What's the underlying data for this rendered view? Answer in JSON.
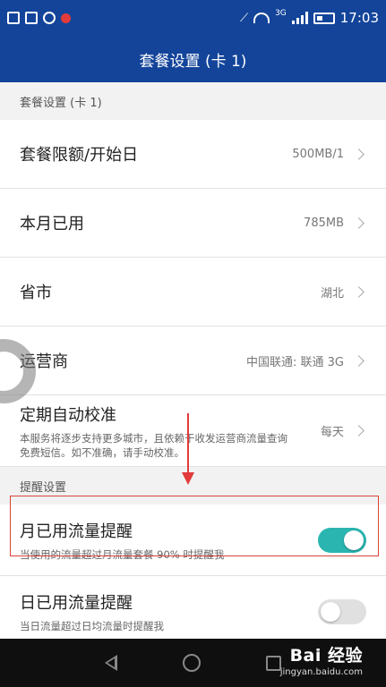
{
  "status_bar": {
    "time": "17:03",
    "network": "3G",
    "notification_icons": [
      "battery-saver-icon",
      "image-icon",
      "pause-icon",
      "red-dot-icon"
    ]
  },
  "title_bar": {
    "title": "套餐设置 (卡 1)"
  },
  "sections": {
    "plan": {
      "header": "套餐设置 (卡 1)"
    },
    "reminders": {
      "header": "提醒设置"
    }
  },
  "plan_rows": {
    "limit": {
      "title": "套餐限额/开始日",
      "value": "500MB/1"
    },
    "used": {
      "title": "本月已用",
      "value": "785MB"
    },
    "province": {
      "title": "省市",
      "value": "湖北"
    },
    "carrier": {
      "title": "运营商",
      "value": "中国联通: 联通 3G"
    },
    "auto_calibrate": {
      "title": "定期自动校准",
      "subtitle": "本服务将逐步支持更多城市，且依赖于收发运营商流量查询免费短信。如不准确，请手动校准。",
      "value": "每天"
    }
  },
  "reminder_rows": {
    "monthly": {
      "title": "月已用流量提醒",
      "subtitle": "当使用的流量超过月流量套餐 90% 时提醒我",
      "enabled": true
    },
    "daily": {
      "title": "日已用流量提醒",
      "subtitle": "当日流量超过日均流量时提醒我",
      "enabled": false
    }
  },
  "watermark": {
    "main": "Bai 经验",
    "sub": "jingyan.baidu.com"
  },
  "colors": {
    "status_bar": "#13449a",
    "toggle_on": "#2bb5b0",
    "toggle_off": "#e0e0e0",
    "annotation": "#e23b3b"
  }
}
